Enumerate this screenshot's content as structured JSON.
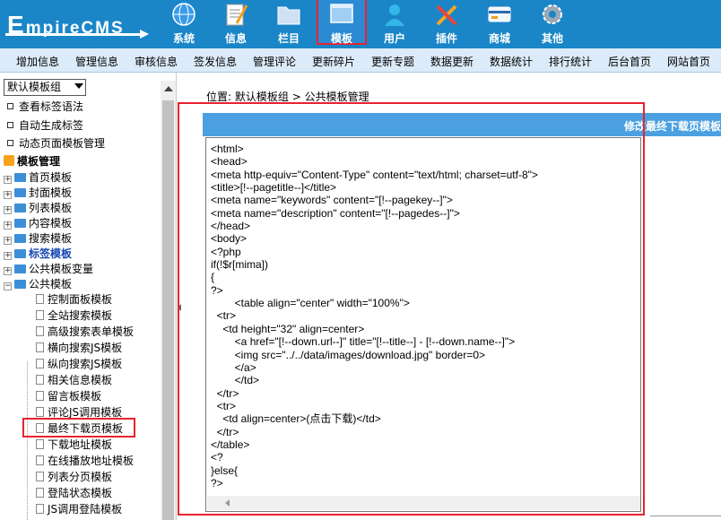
{
  "logo": {
    "first": "E",
    "rest": "mpireCMS"
  },
  "nav": [
    {
      "label": "系统",
      "icon": "globe-icon",
      "active": false
    },
    {
      "label": "信息",
      "icon": "notepad-icon",
      "active": false
    },
    {
      "label": "栏目",
      "icon": "folder-icon",
      "active": false
    },
    {
      "label": "模板",
      "icon": "window-icon",
      "active": true
    },
    {
      "label": "用户",
      "icon": "user-icon",
      "active": false
    },
    {
      "label": "插件",
      "icon": "tools-icon",
      "active": false
    },
    {
      "label": "商城",
      "icon": "card-icon",
      "active": false
    },
    {
      "label": "其他",
      "icon": "gear-icon",
      "active": false
    }
  ],
  "submenu": [
    "增加信息",
    "管理信息",
    "审核信息",
    "签发信息",
    "管理评论",
    "更新碎片",
    "更新专题",
    "数据更新",
    "数据统计",
    "排行统计",
    "后台首页",
    "网站首页"
  ],
  "sidebar": {
    "group_select": "默认模板组",
    "links": [
      "查看标签语法",
      "自动生成标签",
      "动态页面模板管理"
    ],
    "tree_root": "模板管理",
    "folders": [
      "首页模板",
      "封面模板",
      "列表模板",
      "内容模板",
      "搜索模板",
      "标签模板",
      "公共模板变量",
      "公共模板"
    ],
    "leaves": [
      "控制面板模板",
      "全站搜索模板",
      "高级搜索表单模板",
      "横向搜索JS模板",
      "纵向搜索JS模板",
      "相关信息模板",
      "留言板模板",
      "评论JS调用模板",
      "最终下载页模板",
      "下载地址模板",
      "在线播放地址模板",
      "列表分页模板",
      "登陆状态模板",
      "JS调用登陆模板"
    ]
  },
  "breadcrumb": {
    "prefix": "位置: ",
    "group": "默认模板组",
    "sep": " > ",
    "page": "公共模板管理"
  },
  "panel": {
    "title": "修改最终下载页模板"
  },
  "code": "<html>\n<head>\n<meta http-equiv=\"Content-Type\" content=\"text/html; charset=utf-8\">\n<title>[!--pagetitle--]</title>\n<meta name=\"keywords\" content=\"[!--pagekey--]\">\n<meta name=\"description\" content=\"[!--pagedes--]\">\n</head>\n<body>\n<?php\nif(!$r[mima])\n{\n?>\n        <table align=\"center\" width=\"100%\">\n  <tr>\n    <td height=\"32\" align=center>\n        <a href=\"[!--down.url--]\" title=\"[!--title--] - [!--down.name--]\">\n        <img src=\"../../data/images/download.jpg\" border=0>\n        </a>\n        </td>\n  </tr>\n  <tr>\n    <td align=center>(点击下载)</td>\n  </tr>\n</table>\n<?\n}else{\n?>"
}
